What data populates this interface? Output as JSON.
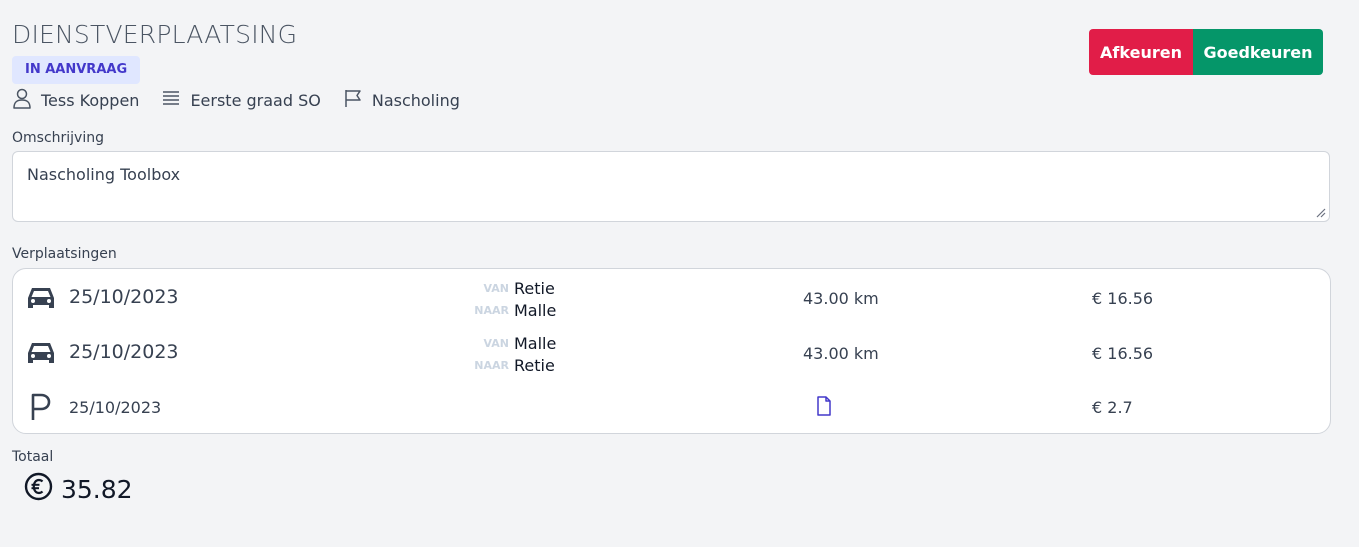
{
  "header": {
    "title": "DIENSTVERPLAATSING",
    "status": "IN AANVRAAG",
    "person": "Tess Koppen",
    "group": "Eerste graad SO",
    "category": "Nascholing"
  },
  "actions": {
    "reject_label": "Afkeuren",
    "approve_label": "Goedkeuren",
    "reject_color": "#e11d48",
    "approve_color": "#059669"
  },
  "description": {
    "label": "Omschrijving",
    "value": "Nascholing Toolbox"
  },
  "trips": {
    "label": "Verplaatsingen",
    "from_tag": "VAN",
    "to_tag": "NAAR",
    "rows": [
      {
        "icon": "car-icon",
        "date": "25/10/2023",
        "from": "Retie",
        "to": "Malle",
        "distance": "43.00 km",
        "cost": "€ 16.56"
      },
      {
        "icon": "car-icon",
        "date": "25/10/2023",
        "from": "Malle",
        "to": "Retie",
        "distance": "43.00 km",
        "cost": "€ 16.56"
      },
      {
        "icon": "parking-icon",
        "date": "25/10/2023",
        "attachment_icon": "document-icon",
        "cost": "€ 2.7"
      }
    ]
  },
  "total": {
    "label": "Totaal",
    "icon": "euro-circle-icon",
    "value": "35.82"
  }
}
